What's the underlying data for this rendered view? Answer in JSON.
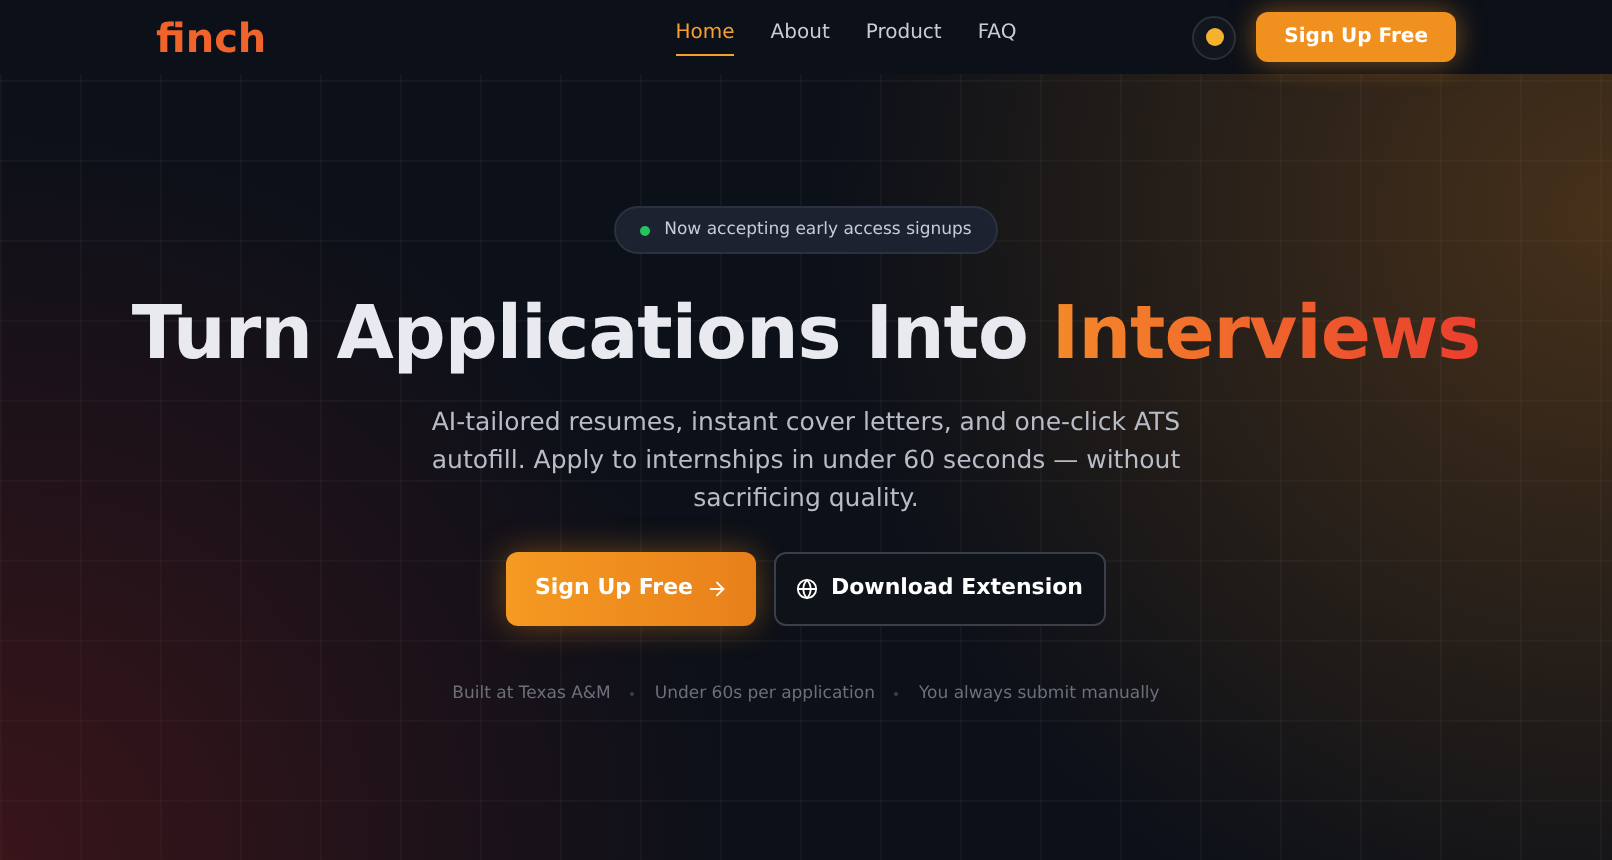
{
  "nav": {
    "logo": "finch",
    "links": [
      {
        "label": "Home",
        "selected": true
      },
      {
        "label": "About",
        "selected": false
      },
      {
        "label": "Product",
        "selected": false
      },
      {
        "label": "FAQ",
        "selected": false
      }
    ],
    "cta": "Sign Up Free"
  },
  "badge": {
    "text": "Now accepting early access signups",
    "color": "#22c55e"
  },
  "headline": {
    "text": "Turn Applications Into",
    "highlight": "Interviews"
  },
  "subtitle": "AI-tailored resumes, instant cover letters, and one-click ATS autofill. Apply to internships in under 60 seconds — without sacrificing quality.",
  "buttons": {
    "primary": "Sign Up Free",
    "secondary": "Download Extension"
  },
  "facts": [
    "Built at Texas A&M",
    "Under 60s per application",
    "You always submit manually"
  ]
}
